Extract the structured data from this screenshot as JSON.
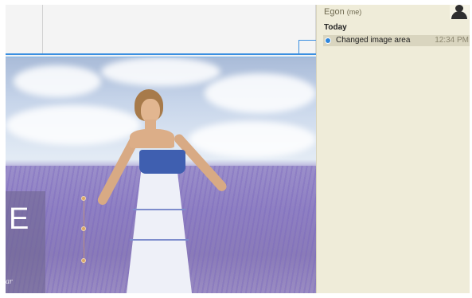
{
  "history": {
    "user_name": "Egon",
    "user_tag": "(me)",
    "section": "Today",
    "entries": [
      {
        "label": "Changed image area",
        "time": "12:34 PM"
      }
    ]
  },
  "overlay": {
    "letter": "E",
    "caption": "ar"
  },
  "colors": {
    "selection": "#3b8fe0",
    "sidebar_bg": "#efecd9",
    "entry_highlight": "#d9d5bf"
  },
  "icons": [
    "avatar-icon",
    "history-dot-icon"
  ]
}
